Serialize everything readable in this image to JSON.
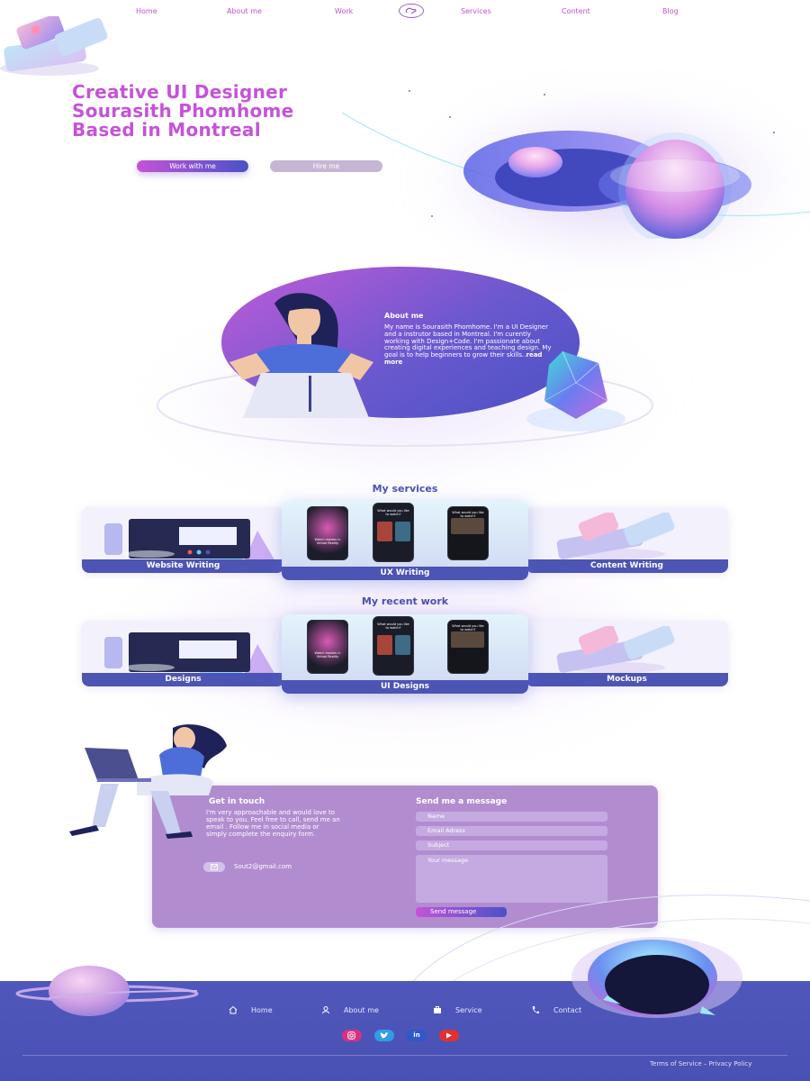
{
  "nav": {
    "items": [
      "Home",
      "About me",
      "Work",
      "Services",
      "Content",
      "Blog"
    ]
  },
  "hero": {
    "title_line1": "Creative UI Designer",
    "title_line2": "Sourasith Phomhome",
    "title_line3": "Based in Montreal",
    "primary_button": "Work with me",
    "secondary_button": "Hire me"
  },
  "about": {
    "title": "About me",
    "text": "My name is Sourasith Phomhome. I'm a UI Designer and a instrutor based in Montreal. I'm curently working with Design+Code. I'm passionate about creating digital experiences and teaching design. My goal is to help beginners to grow their skills..",
    "read_more": "read more"
  },
  "services": {
    "title": "My services",
    "cards": [
      "Website Writing",
      "UX Writing",
      "Content Writing"
    ]
  },
  "recent_work": {
    "title": "My recent work",
    "cards": [
      "Designs",
      "UI Designs",
      "Mockups"
    ]
  },
  "phones": {
    "screen1_text": "Watch movies in Virtual Reality",
    "screen2_text": "What would you like to watch?",
    "screen3_text": "What would you like to watch?"
  },
  "contact": {
    "left_title": "Get in touch",
    "left_text": "I'm very approachable and would love to speak to you. Feel free to call, send me an email . Follow me in social media or simply complete the enquiry form.",
    "email": "Sout2@gmail.com",
    "right_title": "Send me a message",
    "name_placeholder": "Name",
    "email_placeholder": "Email Adress",
    "subject_placeholder": "Subject",
    "message_placeholder": "Your message",
    "send_button": "Send message"
  },
  "footer": {
    "links": [
      "Home",
      "About me",
      "Service",
      "Contact"
    ],
    "social": [
      "instagram",
      "twitter",
      "in",
      "youtube"
    ],
    "linkedin_label": "in",
    "terms": "Terms of Service – Privacy Policy"
  },
  "colors": {
    "accent_pink": "#c553d8",
    "accent_blue": "#4c54b4",
    "contact_bg": "#b18dd0",
    "footer_bg": "#4f57bb"
  }
}
